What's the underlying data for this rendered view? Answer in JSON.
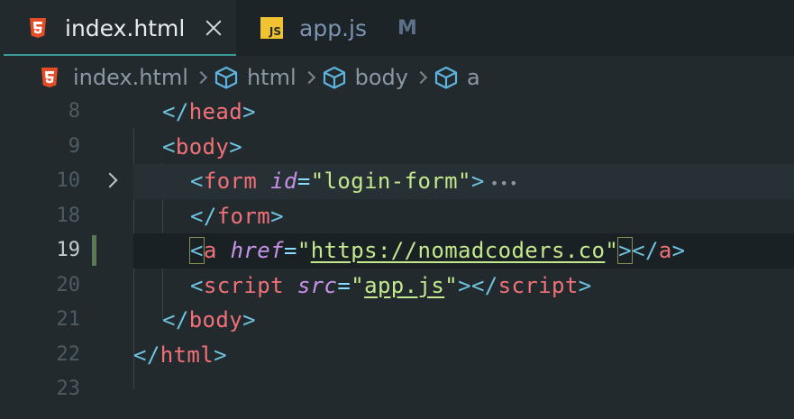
{
  "tabs": [
    {
      "label": "index.html",
      "icon": "html5-icon",
      "active": true
    },
    {
      "label": "app.js",
      "icon": "js-icon",
      "badge": "M",
      "active": false
    }
  ],
  "js_icon_text": "JS",
  "breadcrumb": [
    {
      "label": "index.html",
      "icon": "html5-icon"
    },
    {
      "label": "html",
      "icon": "cube-icon"
    },
    {
      "label": "body",
      "icon": "cube-icon"
    },
    {
      "label": "a",
      "icon": "cube-icon"
    }
  ],
  "editor": {
    "current_line": "19",
    "lines": [
      {
        "number": "8",
        "tokens": [
          [
            "t-punc",
            "</"
          ],
          [
            "t-tag",
            "head"
          ],
          [
            "t-punc",
            ">"
          ]
        ]
      },
      {
        "number": "9",
        "tokens": [
          [
            "t-punc",
            "<"
          ],
          [
            "t-tag",
            "body"
          ],
          [
            "t-punc",
            ">"
          ]
        ]
      },
      {
        "number": "10",
        "tokens": [
          [
            "t-punc",
            "<"
          ],
          [
            "t-tag",
            "form"
          ],
          [
            "",
            ""
          ],
          [
            "t-attr",
            "id"
          ],
          [
            "t-eq",
            "="
          ],
          [
            "t-str",
            "\"login-form\""
          ],
          [
            "t-punc",
            ">"
          ]
        ]
      },
      {
        "number": "18",
        "tokens": [
          [
            "t-punc",
            "</"
          ],
          [
            "t-tag",
            "form"
          ],
          [
            "t-punc",
            ">"
          ]
        ]
      },
      {
        "number": "19",
        "tokens": [
          [
            "t-punc",
            "<"
          ],
          [
            "t-tag",
            "a"
          ],
          [
            "",
            ""
          ],
          [
            "t-attr",
            "href"
          ],
          [
            "t-eq",
            "="
          ],
          [
            "t-str",
            "\""
          ],
          [
            "t-link",
            "https://nomadcoders.co"
          ],
          [
            "t-str",
            "\""
          ],
          [
            "t-punc",
            ">"
          ],
          [
            "t-punc",
            "</"
          ],
          [
            "t-tag",
            "a"
          ],
          [
            "t-punc",
            ">"
          ]
        ]
      },
      {
        "number": "20",
        "tokens": [
          [
            "t-punc",
            "<"
          ],
          [
            "t-tag",
            "script"
          ],
          [
            "",
            ""
          ],
          [
            "t-attr",
            "src"
          ],
          [
            "t-eq",
            "="
          ],
          [
            "t-str",
            "\""
          ],
          [
            "t-link",
            "app.js"
          ],
          [
            "t-str",
            "\""
          ],
          [
            "t-punc",
            ">"
          ],
          [
            "t-punc",
            "</"
          ],
          [
            "t-tag",
            "script"
          ],
          [
            "t-punc",
            ">"
          ]
        ]
      },
      {
        "number": "21",
        "tokens": [
          [
            "t-punc",
            "</"
          ],
          [
            "t-tag",
            "body"
          ],
          [
            "t-punc",
            ">"
          ]
        ]
      },
      {
        "number": "22",
        "tokens": [
          [
            "t-punc",
            "</"
          ],
          [
            "t-tag",
            "html"
          ],
          [
            "t-punc",
            ">"
          ]
        ]
      },
      {
        "number": "23",
        "tokens": []
      }
    ]
  },
  "colors": {
    "background": "#222a2e",
    "tab_accent": "#3c9a9a",
    "tag": "#f07178",
    "punctuation": "#6fc3e0",
    "attribute": "#c792ea",
    "string": "#c3e88d",
    "html5_orange": "#e44d26",
    "js_yellow": "#f1c232",
    "cube_blue": "#5fb4de"
  }
}
